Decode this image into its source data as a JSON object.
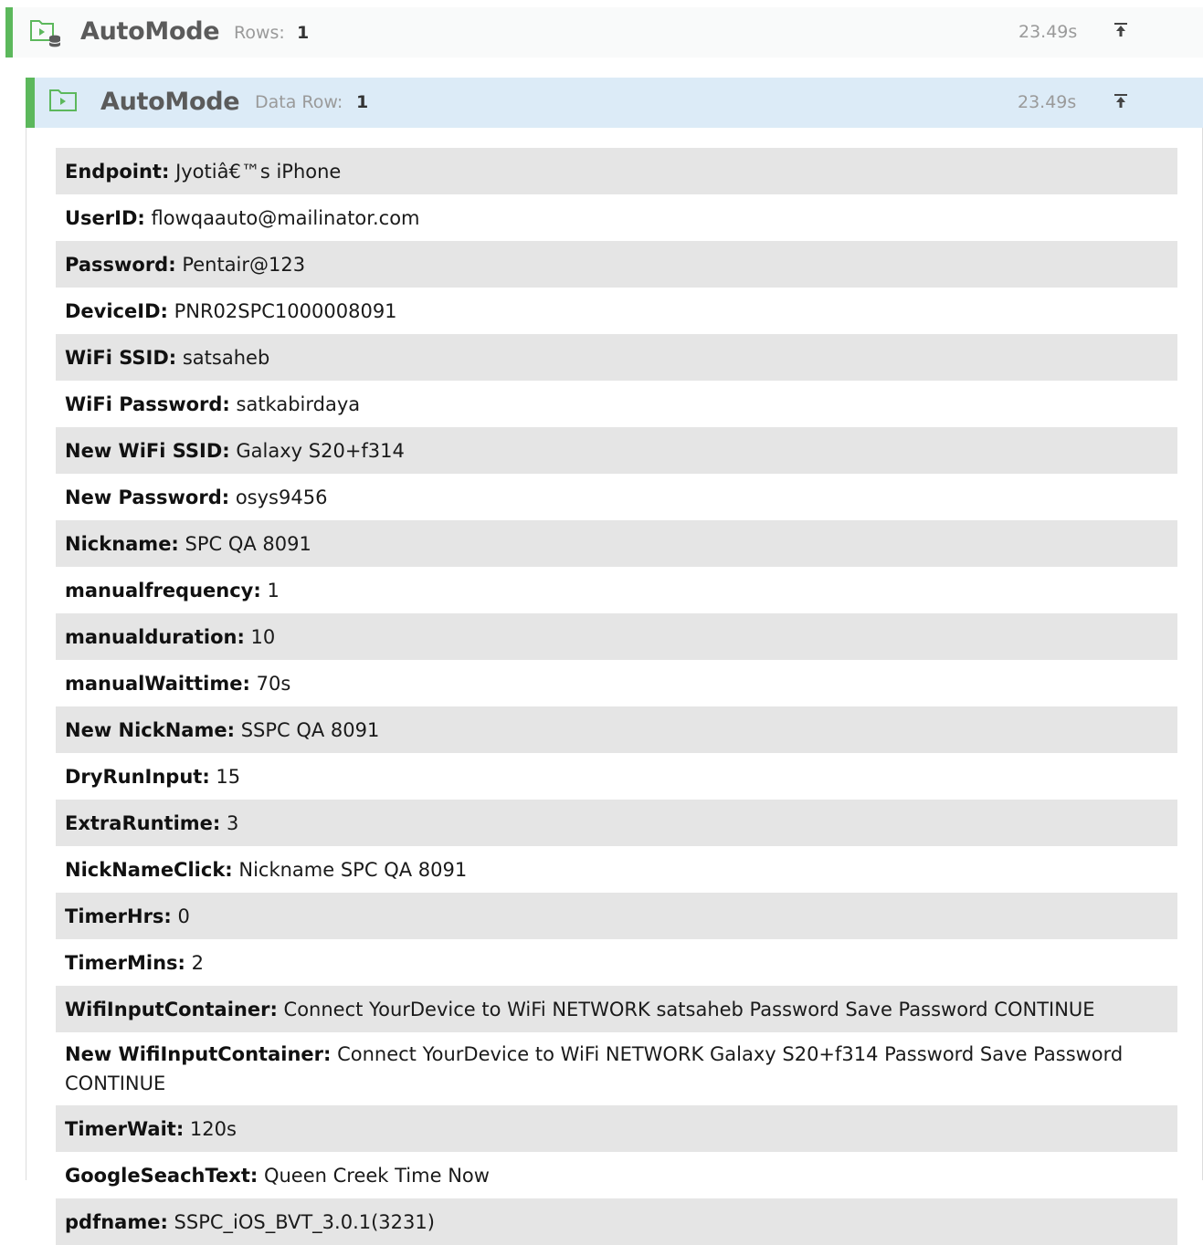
{
  "outer": {
    "title": "AutoMode",
    "meta_label": "Rows:",
    "meta_value": "1",
    "duration": "23.49s",
    "icon": "test-data-icon",
    "collapse_icon": "collapse-up-icon"
  },
  "inner": {
    "title": "AutoMode",
    "meta_label": "Data Row:",
    "meta_value": "1",
    "duration": "23.49s",
    "icon": "play-folder-icon",
    "collapse_icon": "collapse-up-icon"
  },
  "params": [
    {
      "key": "Endpoint:",
      "value": "Jyotiâ€™s iPhone"
    },
    {
      "key": "UserID:",
      "value": "flowqaauto@mailinator.com"
    },
    {
      "key": "Password:",
      "value": "Pentair@123"
    },
    {
      "key": "DeviceID:",
      "value": "PNR02SPC1000008091"
    },
    {
      "key": "WiFi SSID:",
      "value": "satsaheb"
    },
    {
      "key": "WiFi Password:",
      "value": "satkabirdaya"
    },
    {
      "key": "New WiFi SSID:",
      "value": "Galaxy S20+f314"
    },
    {
      "key": "New Password:",
      "value": "osys9456"
    },
    {
      "key": "Nickname:",
      "value": "SPC QA 8091"
    },
    {
      "key": "manualfrequency:",
      "value": "1"
    },
    {
      "key": "manualduration:",
      "value": "10"
    },
    {
      "key": "manualWaittime:",
      "value": "70s"
    },
    {
      "key": "New NickName:",
      "value": "SSPC QA 8091"
    },
    {
      "key": "DryRunInput:",
      "value": "15"
    },
    {
      "key": "ExtraRuntime:",
      "value": "3"
    },
    {
      "key": "NickNameClick:",
      "value": "Nickname SPC QA 8091"
    },
    {
      "key": "TimerHrs:",
      "value": "0"
    },
    {
      "key": "TimerMins:",
      "value": "2"
    },
    {
      "key": "WifiInputContainer:",
      "value": "Connect YourDevice to WiFi NETWORK satsaheb Password Save Password CONTINUE"
    },
    {
      "key": "New WifiInputContainer:",
      "value": "Connect YourDevice to WiFi NETWORK Galaxy S20+f314 Password Save Password CONTINUE"
    },
    {
      "key": "TimerWait:",
      "value": "120s"
    },
    {
      "key": "GoogleSeachText:",
      "value": "Queen Creek Time Now"
    },
    {
      "key": "pdfname:",
      "value": "SSPC_iOS_BVT_3.0.1(3231)"
    }
  ],
  "colors": {
    "accent_green": "#5cb85c",
    "inner_header_bg": "#dcebf7",
    "row_stripe": "#e5e5e5",
    "title_gray": "#5b5b5b",
    "muted_gray": "#9a9a9a"
  }
}
